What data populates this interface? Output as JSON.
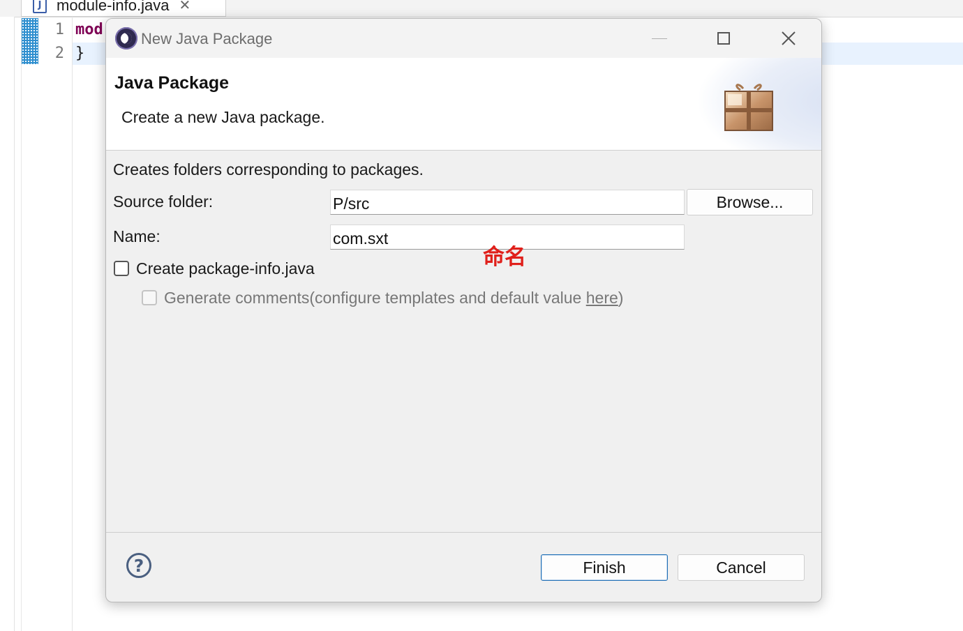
{
  "editor": {
    "tab_label": "module-info.java",
    "tab_icon": "java-file-icon",
    "tab_close_glyph": "✕",
    "tab_file_glyph": "J",
    "lines": [
      {
        "number": "1",
        "text": "mod"
      },
      {
        "number": "2",
        "text": "}"
      }
    ]
  },
  "dialog": {
    "window_title": "New Java Package",
    "banner": {
      "title": "Java Package",
      "description": "Create a new Java package."
    },
    "intro": "Creates folders corresponding to packages.",
    "source_folder": {
      "label": "Source folder:",
      "value": "P/src",
      "browse_label": "Browse..."
    },
    "name": {
      "label": "Name:",
      "value": "com.sxt"
    },
    "create_package_info": {
      "label": "Create package-info.java",
      "checked": false
    },
    "generate_comments": {
      "label": "Generate comments",
      "hint_prefix": "(configure templates and default value ",
      "hint_link": "here",
      "hint_suffix": ")",
      "checked": false,
      "enabled": false
    },
    "finish_label": "Finish",
    "cancel_label": "Cancel",
    "help_glyph": "?"
  },
  "annotation": {
    "text": "命名",
    "color": "#e0201b"
  },
  "colors": {
    "keyword": "#7f0055",
    "default_button_border": "#1f6fb5",
    "current_line": "#e8f2fe"
  }
}
